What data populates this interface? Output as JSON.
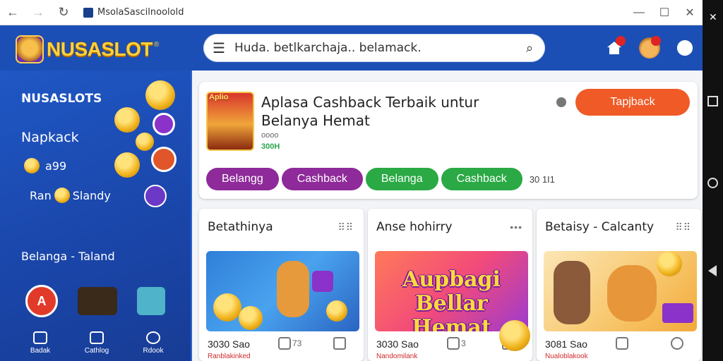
{
  "browser": {
    "tab_title": "MsolaSascilnoolold",
    "back_icon": "arrow-left-icon",
    "forward_icon": "arrow-right-icon",
    "reload_icon": "reload-icon"
  },
  "header": {
    "logo_text": "NUSASLOT",
    "logo_reg": "®",
    "search_value": "Huda. betlkarchaja.. belamack.",
    "icons": [
      "home-icon",
      "bear-avatar-icon",
      "gear-icon"
    ]
  },
  "sidebar": {
    "title": "NUSASLOTS",
    "item1": "Napkack",
    "coin_value": "a99",
    "run_label": "Ran",
    "run_label2": "Slandy",
    "section": "Belanga - Taland",
    "nav": [
      {
        "label": "Badak",
        "icon": "grid-icon"
      },
      {
        "label": "Cathlog",
        "icon": "catalog-icon"
      },
      {
        "label": "Rdook",
        "icon": "search-icon"
      }
    ]
  },
  "promo": {
    "thumb_label": "Aplio",
    "title": "Aplasa Cashback Terbaik untur Belanya Hemat",
    "sub": "oooo",
    "green": "300H",
    "cta": "Tapjback",
    "chips": [
      {
        "label": "Belangg",
        "color": "purple"
      },
      {
        "label": "Cashback",
        "color": "purple"
      },
      {
        "label": "Belanga",
        "color": "green"
      },
      {
        "label": "Cashback",
        "color": "green"
      }
    ],
    "count": "30 1I1"
  },
  "cards": [
    {
      "title": "Betathinya",
      "menu": "⠿⠿",
      "price": "3030 Sao",
      "red": "Ranblakinked",
      "action": "73"
    },
    {
      "title": "Anse hohirry",
      "menu": "•••",
      "price": "3030 Sao",
      "red": "Nandomilank",
      "action": "3",
      "banner": "Aupbagi Bellar Hemat"
    },
    {
      "title": "Betaisy - Calcanty",
      "menu": "⠿⠿",
      "price": "3081 Sao",
      "red": "Nualoblakook",
      "action": ""
    }
  ],
  "colors": {
    "brand_blue": "#1c4fb5",
    "cta_orange": "#f05a26",
    "chip_purple": "#8e2a99",
    "chip_green": "#2aa944",
    "logo_gold": "#ffd23a"
  }
}
